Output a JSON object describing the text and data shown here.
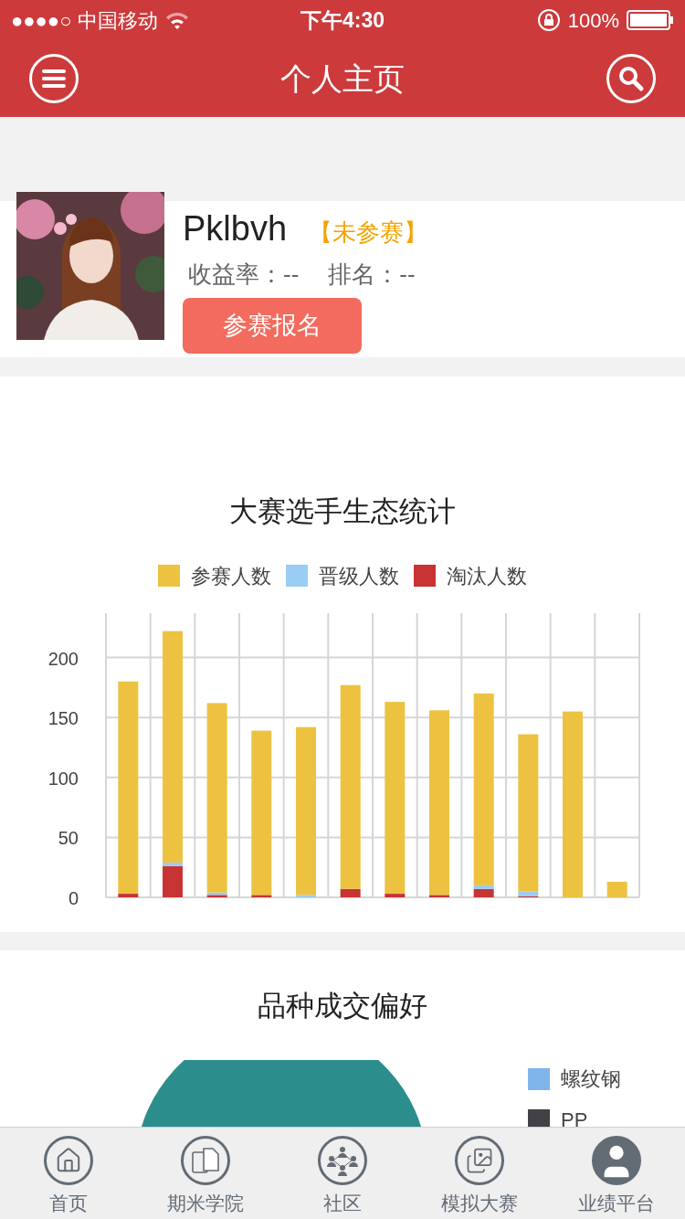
{
  "status_bar": {
    "carrier": "●●●●○ 中国移动",
    "time": "下午4:30",
    "battery": "100%"
  },
  "header": {
    "title": "个人主页"
  },
  "profile": {
    "name": "Pklbvh",
    "status": "【未参赛】",
    "return_label": "收益率：",
    "return_value": "--",
    "rank_label": "排名：",
    "rank_value": "--",
    "signup_button": "参赛报名"
  },
  "stats_chart": {
    "title": "大赛选手生态统计",
    "chart_data": {
      "type": "bar",
      "stacked": true,
      "grid": true,
      "ylim": [
        0,
        237
      ],
      "yticks": [
        0,
        50,
        100,
        150,
        200
      ],
      "series": [
        {
          "name": "淘汰人数",
          "color": "#c83334",
          "values": [
            3,
            26,
            2,
            2,
            0,
            7,
            3,
            2,
            7,
            1,
            0,
            0
          ]
        },
        {
          "name": "晋级人数",
          "color": "#99cdf3",
          "values": [
            0,
            3,
            2,
            0,
            2,
            0,
            0,
            0,
            3,
            4,
            0,
            0
          ]
        },
        {
          "name": "参赛人数",
          "color": "#ecc240",
          "values": [
            177,
            193,
            158,
            137,
            140,
            170,
            160,
            154,
            160,
            131,
            155,
            13
          ]
        }
      ]
    }
  },
  "preference": {
    "title": "品种成交偏好",
    "legend": [
      {
        "label": "螺纹钢",
        "color": "#7fb5ea"
      },
      {
        "label": "PP",
        "color": "#414146"
      }
    ]
  },
  "tab_bar": [
    {
      "label": "首页",
      "kind": "home"
    },
    {
      "label": "期米学院",
      "kind": "school"
    },
    {
      "label": "社区",
      "kind": "community"
    },
    {
      "label": "模拟大赛",
      "kind": "contest"
    },
    {
      "label": "业绩平台",
      "kind": "performance"
    }
  ]
}
